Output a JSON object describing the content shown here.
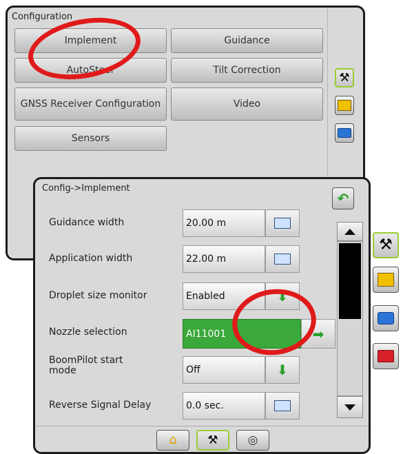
{
  "config_panel": {
    "title": "Configuration",
    "buttons": [
      "Implement",
      "Guidance",
      "AutoSteer",
      "Tilt Correction",
      "GNSS Receiver Configuration",
      "Video",
      "Sensors"
    ]
  },
  "implement_panel": {
    "title": "Config->Implement",
    "rows": [
      {
        "label": "Guidance width",
        "value": "20.00 m",
        "control": "keyboard-icon"
      },
      {
        "label": "Application width",
        "value": "22.00 m",
        "control": "keyboard-icon"
      },
      {
        "label": "Droplet size monitor",
        "value": "Enabled",
        "control": "down-arrow-icon"
      },
      {
        "label": "Nozzle selection",
        "value": "AI11001",
        "control": "right-arrow-icon"
      },
      {
        "label": "BoomPilot start mode",
        "value": "Off",
        "control": "down-arrow-icon"
      },
      {
        "label": "Reverse Signal Delay",
        "value": "0.0 sec.",
        "control": "keyboard-icon"
      }
    ]
  },
  "colors": {
    "highlight": "#e01a1a",
    "selected_green": "#3aa83a",
    "active_border": "#9acd32"
  }
}
